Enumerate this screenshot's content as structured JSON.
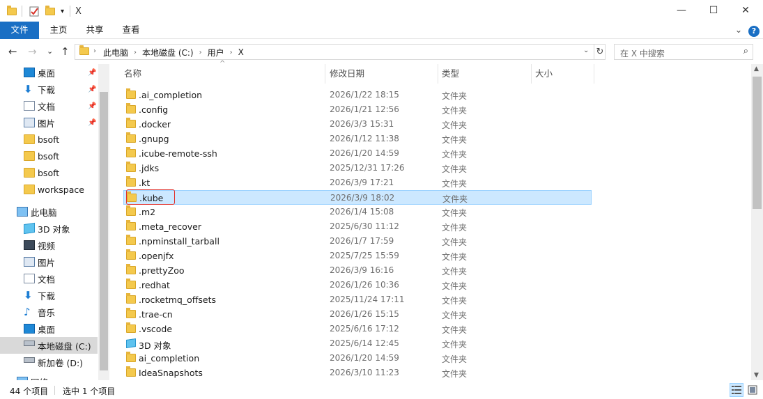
{
  "window": {
    "minimize": "—",
    "maximize": "☐",
    "close": "✕",
    "title_sep": "X"
  },
  "ribbon": {
    "tabs": [
      "文件",
      "主页",
      "共享",
      "查看"
    ],
    "collapse": "⌄",
    "help": "?"
  },
  "nav": {
    "back": "←",
    "forward": "→",
    "recent": "⌄",
    "up": "↑"
  },
  "address": {
    "crumbs": [
      "此电脑",
      "本地磁盘 (C:)",
      "用户",
      "X"
    ],
    "separator": "›",
    "dropdown": "⌄",
    "refresh": "↻"
  },
  "search": {
    "placeholder": "在 X 中搜索",
    "icon": "⌕"
  },
  "navpane": {
    "items": [
      {
        "label": "桌面",
        "icon": "desktop-icon",
        "pinned": true
      },
      {
        "label": "下载",
        "icon": "download-icon",
        "pinned": true
      },
      {
        "label": "文档",
        "icon": "document-icon",
        "pinned": true
      },
      {
        "label": "图片",
        "icon": "picture-icon",
        "pinned": true
      },
      {
        "label": "bsoft",
        "icon": "folder-icon",
        "pinned": false
      },
      {
        "label": "bsoft",
        "icon": "folder-icon",
        "pinned": false
      },
      {
        "label": "bsoft",
        "icon": "folder-icon",
        "pinned": false
      },
      {
        "label": "workspace",
        "icon": "folder-icon",
        "pinned": false
      },
      {
        "label": "此电脑",
        "icon": "this-pc-icon",
        "pinned": false
      },
      {
        "label": "3D 对象",
        "icon": "3d-objects-icon",
        "pinned": false
      },
      {
        "label": "视频",
        "icon": "video-icon",
        "pinned": false
      },
      {
        "label": "图片",
        "icon": "picture-icon",
        "pinned": false
      },
      {
        "label": "文档",
        "icon": "document-icon",
        "pinned": false
      },
      {
        "label": "下载",
        "icon": "download-icon",
        "pinned": false
      },
      {
        "label": "音乐",
        "icon": "music-icon",
        "pinned": false
      },
      {
        "label": "桌面",
        "icon": "desktop-icon",
        "pinned": false
      },
      {
        "label": "本地磁盘 (C:)",
        "icon": "drive-icon",
        "pinned": false,
        "selected": true
      },
      {
        "label": "新加卷 (D:)",
        "icon": "drive-icon",
        "pinned": false
      },
      {
        "label": "网络",
        "icon": "network-icon",
        "pinned": false
      }
    ],
    "pin_glyph": "📌"
  },
  "columns": {
    "name": "名称",
    "modified": "修改日期",
    "type": "类型",
    "size": "大小",
    "sort_indicator": "^"
  },
  "files": [
    {
      "name": ".ai_completion",
      "date": "2026/1/22 18:15",
      "type": "文件夹",
      "icon": "folder-icon"
    },
    {
      "name": ".config",
      "date": "2026/1/21 12:56",
      "type": "文件夹",
      "icon": "folder-icon"
    },
    {
      "name": ".docker",
      "date": "2026/3/3 15:31",
      "type": "文件夹",
      "icon": "folder-icon"
    },
    {
      "name": ".gnupg",
      "date": "2026/1/12 11:38",
      "type": "文件夹",
      "icon": "folder-icon"
    },
    {
      "name": ".icube-remote-ssh",
      "date": "2026/1/20 14:59",
      "type": "文件夹",
      "icon": "folder-icon"
    },
    {
      "name": ".jdks",
      "date": "2025/12/31 17:26",
      "type": "文件夹",
      "icon": "folder-icon"
    },
    {
      "name": ".kt",
      "date": "2026/3/9 17:21",
      "type": "文件夹",
      "icon": "folder-icon"
    },
    {
      "name": ".kube",
      "date": "2026/3/9 18:02",
      "type": "文件夹",
      "icon": "folder-icon",
      "selected": true
    },
    {
      "name": ".m2",
      "date": "2026/1/4 15:08",
      "type": "文件夹",
      "icon": "folder-icon"
    },
    {
      "name": ".meta_recover",
      "date": "2025/6/30 11:12",
      "type": "文件夹",
      "icon": "folder-icon"
    },
    {
      "name": ".npminstall_tarball",
      "date": "2026/1/7 17:59",
      "type": "文件夹",
      "icon": "folder-icon"
    },
    {
      "name": ".openjfx",
      "date": "2025/7/25 15:59",
      "type": "文件夹",
      "icon": "folder-icon"
    },
    {
      "name": ".prettyZoo",
      "date": "2026/3/9 16:16",
      "type": "文件夹",
      "icon": "folder-icon"
    },
    {
      "name": ".redhat",
      "date": "2026/1/26 10:36",
      "type": "文件夹",
      "icon": "folder-icon"
    },
    {
      "name": ".rocketmq_offsets",
      "date": "2025/11/24 17:11",
      "type": "文件夹",
      "icon": "folder-icon"
    },
    {
      "name": ".trae-cn",
      "date": "2026/1/26 15:15",
      "type": "文件夹",
      "icon": "folder-icon"
    },
    {
      "name": ".vscode",
      "date": "2025/6/16 17:12",
      "type": "文件夹",
      "icon": "folder-icon"
    },
    {
      "name": "3D 对象",
      "date": "2025/6/14 12:45",
      "type": "文件夹",
      "icon": "3d-objects-icon"
    },
    {
      "name": "ai_completion",
      "date": "2026/1/20 14:59",
      "type": "文件夹",
      "icon": "folder-icon"
    },
    {
      "name": "IdeaSnapshots",
      "date": "2026/3/10 11:23",
      "type": "文件夹",
      "icon": "folder-icon"
    }
  ],
  "status": {
    "count": "44 个项目",
    "selection": "选中 1 个项目"
  },
  "scroll": {
    "up": "▲",
    "down": "▼"
  }
}
